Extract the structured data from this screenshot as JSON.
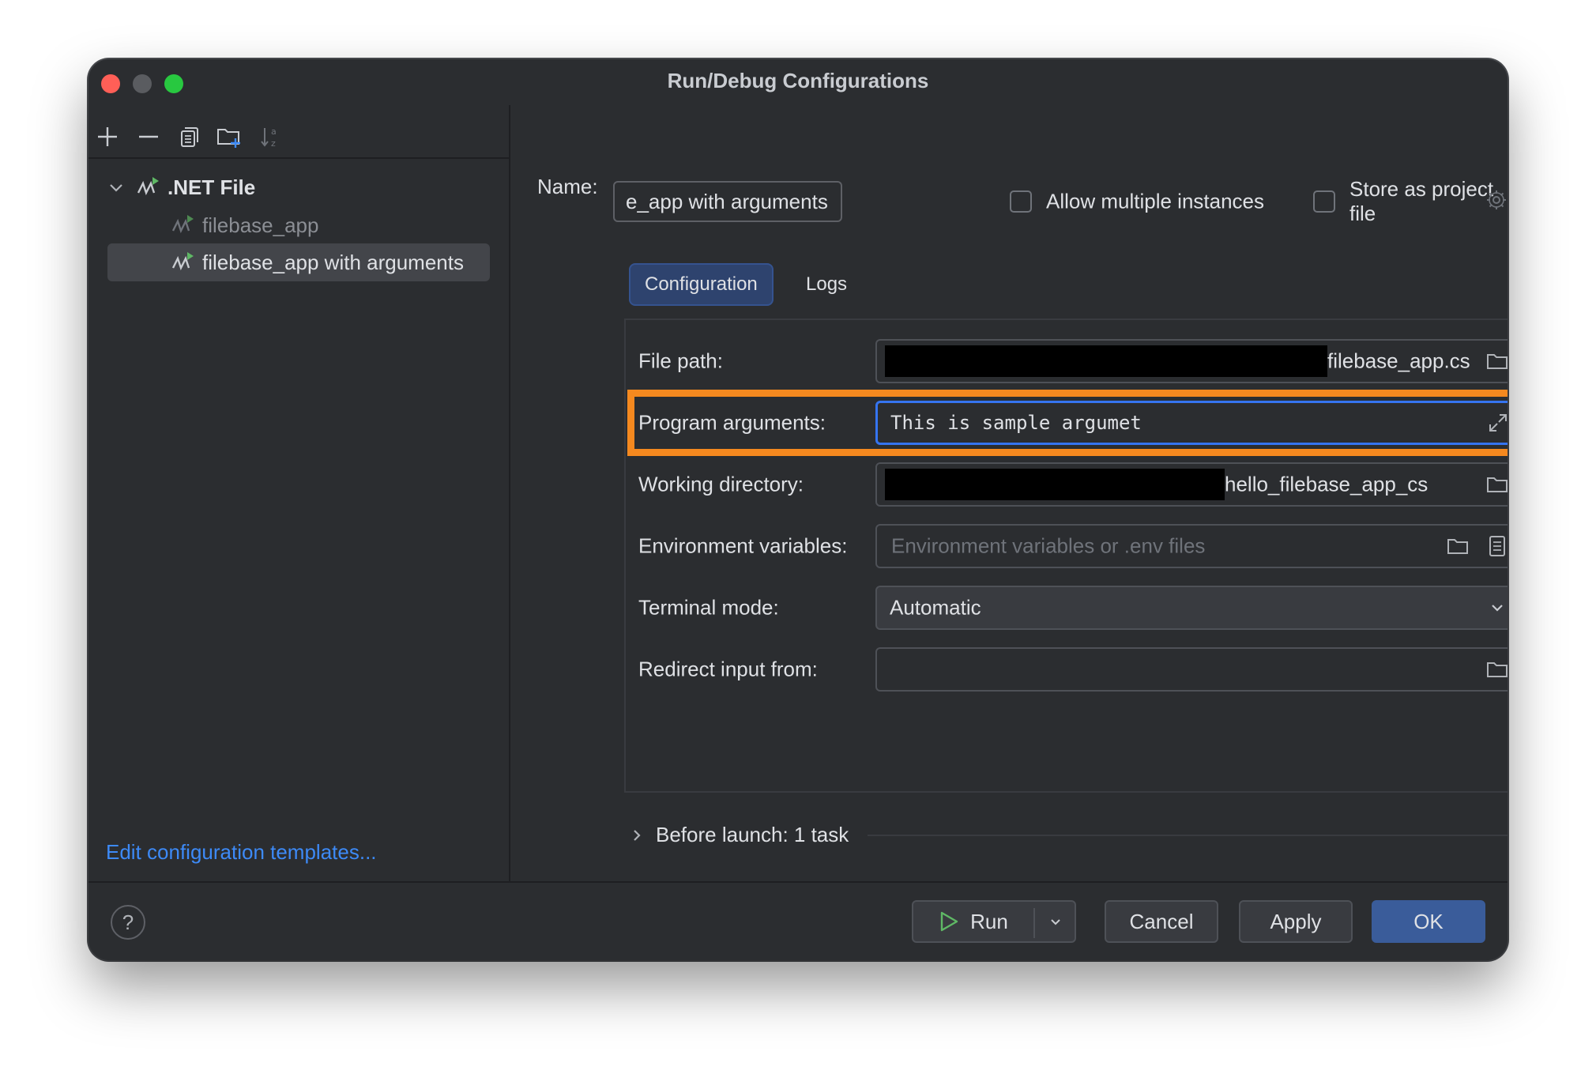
{
  "window": {
    "title": "Run/Debug Configurations"
  },
  "toolbar": {
    "icons": [
      "add-icon",
      "remove-icon",
      "copy-icon",
      "new-folder-icon",
      "sort-icon"
    ]
  },
  "tree": {
    "group_label": ".NET File",
    "items": [
      {
        "label": "filebase_app"
      },
      {
        "label": "filebase_app with arguments"
      }
    ]
  },
  "edit_templates_label": "Edit configuration templates...",
  "name": {
    "label": "Name:",
    "value": "е_app with arguments"
  },
  "allow_multiple": {
    "label": "Allow multiple instances"
  },
  "store_project": {
    "label": "Store as project file"
  },
  "tabs": [
    {
      "label": "Configuration"
    },
    {
      "label": "Logs"
    }
  ],
  "form": {
    "file_path": {
      "label": "File path:",
      "value_suffix": "filebase_app.cs"
    },
    "program_arguments": {
      "label": "Program arguments:",
      "value": "This is sample argumet"
    },
    "working_directory": {
      "label": "Working directory:",
      "value_suffix": "hello_filebase_app_cs"
    },
    "environment_variables": {
      "label": "Environment variables:",
      "placeholder": "Environment variables or .env files"
    },
    "terminal_mode": {
      "label": "Terminal mode:",
      "value": "Automatic"
    },
    "redirect_input": {
      "label": "Redirect input from:",
      "value": ""
    }
  },
  "before_launch": {
    "label": "Before launch: 1 task"
  },
  "buttons": {
    "help": "?",
    "run": "Run",
    "cancel": "Cancel",
    "apply": "Apply",
    "ok": "OK"
  },
  "colors": {
    "background": "#2b2d30",
    "accent": "#3574f0",
    "link": "#3d8af7",
    "highlight": "#f5891f",
    "run_green": "#5fb865"
  }
}
